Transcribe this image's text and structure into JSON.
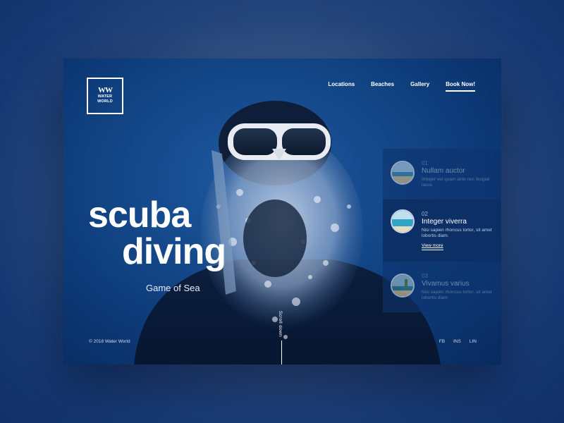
{
  "brand": {
    "mark": "WW",
    "line1": "WATER",
    "line2": "WORLD"
  },
  "nav": {
    "items": [
      {
        "label": "Locations"
      },
      {
        "label": "Beaches"
      },
      {
        "label": "Gallery"
      },
      {
        "label": "Book Now!"
      }
    ]
  },
  "hero": {
    "line1": "scuba",
    "line2": "diving",
    "subtitle": "Game of Sea"
  },
  "scroll_hint": "Scroll down",
  "footer": {
    "copyright": "© 2018 Water World",
    "social": [
      "FB",
      "INS",
      "LIN"
    ]
  },
  "slides": [
    {
      "num": "01",
      "title": "Nullam auctor",
      "desc": "Integer vel quam ante nec feugiat lacus",
      "state": "inactive"
    },
    {
      "num": "02",
      "title": "Integer viverra",
      "desc": "Nisi sapien rhoncus tortor, sit amet lobortis diam.",
      "link": "View more",
      "state": "active"
    },
    {
      "num": "03",
      "title": "Vivamus varius",
      "desc": "Nisi sapien rhoncus tortor, sit amet lobortis diam",
      "state": "inactive"
    }
  ],
  "colors": {
    "accent": "#ffffff",
    "background": "#0d3a78",
    "panel_active": "#0c2f66"
  }
}
